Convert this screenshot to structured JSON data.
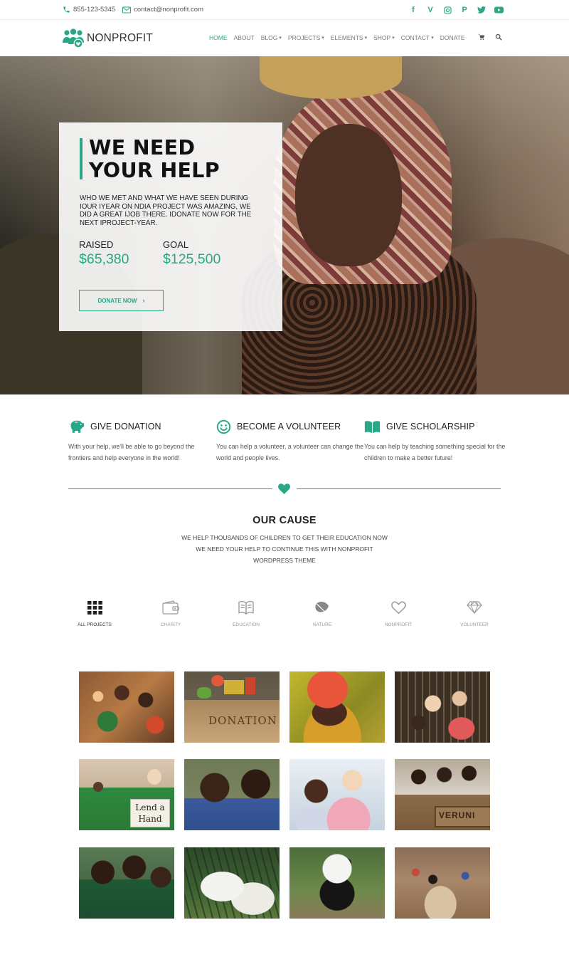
{
  "topbar": {
    "phone": "855-123-5345",
    "email": "contact@nonprofit.com",
    "social_icons": [
      "facebook-icon",
      "vine-icon",
      "instagram-icon",
      "paypal-icon",
      "twitter-icon",
      "youtube-icon"
    ]
  },
  "brand": {
    "name": "NONPROFIT",
    "accent_color": "#2aa787"
  },
  "nav": {
    "items": [
      {
        "label": "HOME",
        "active": true,
        "dropdown": false
      },
      {
        "label": "ABOUT",
        "active": false,
        "dropdown": false
      },
      {
        "label": "BLOG",
        "active": false,
        "dropdown": true
      },
      {
        "label": "PROJECTS",
        "active": false,
        "dropdown": true
      },
      {
        "label": "ELEMENTS",
        "active": false,
        "dropdown": true
      },
      {
        "label": "SHOP",
        "active": false,
        "dropdown": true
      },
      {
        "label": "CONTACT",
        "active": false,
        "dropdown": true
      },
      {
        "label": "DONATE",
        "active": false,
        "dropdown": false
      }
    ],
    "icons": [
      "cart-icon",
      "search-icon"
    ]
  },
  "hero": {
    "title_line1": "WE NEED",
    "title_line2": "YOUR HELP",
    "description": "WHO WE MET AND WHAT WE HAVE SEEN DURING IOUR IYEAR ON NDIA PROJECT WAS AMAZING, WE DID A GREAT IJOB THERE. IDONATE NOW FOR THE NEXT IPROJECT-YEAR.",
    "raised_label": "RAISED",
    "raised_value": "$65,380",
    "goal_label": "GOAL",
    "goal_value": "$125,500",
    "button_label": "DONATE NOW"
  },
  "features": [
    {
      "title": "GIVE DONATION",
      "icon": "piggy-bank-icon",
      "text": "With your help, we'll be able to go beyond the frontiers and help everyone in the world!"
    },
    {
      "title": "BECOME A VOLUNTEER",
      "icon": "smile-icon",
      "text": "You can help a volunteer, a volunteer can change the world and people lives."
    },
    {
      "title": "GIVE SCHOLARSHIP",
      "icon": "book-icon",
      "text": "You can help by teaching something special for the children to make a better future!"
    }
  ],
  "cause": {
    "title": "OUR CAUSE",
    "line1": "WE HELP THOUSANDS OF CHILDREN TO GET THEIR EDUCATION NOW",
    "line2": "WE NEED YOUR HELP TO CONTINUE THIS WITH NONPROFIT",
    "line3": "WORDPRESS THEME"
  },
  "filters": [
    {
      "label": "ALL PROJECTS",
      "icon": "grid-icon",
      "active": true
    },
    {
      "label": "CHARITY",
      "icon": "wallet-icon",
      "active": false
    },
    {
      "label": "EDUCATION",
      "icon": "book-open-icon",
      "active": false
    },
    {
      "label": "NATURE",
      "icon": "leaf-icon",
      "active": false
    },
    {
      "label": "NONPROFIT",
      "icon": "heart-icon",
      "active": false
    },
    {
      "label": "VOLUNTEER",
      "icon": "diamond-icon",
      "active": false
    }
  ],
  "gallery": [
    {
      "name": "children-group-photo"
    },
    {
      "name": "donation-box-photo",
      "label": "DONATION"
    },
    {
      "name": "woman-headwrap-photo"
    },
    {
      "name": "reading-children-photo"
    },
    {
      "name": "lend-a-hand-photo",
      "label": "Lend a Hand"
    },
    {
      "name": "two-boys-photo"
    },
    {
      "name": "teacher-child-photo"
    },
    {
      "name": "classroom-photo",
      "label": "VERUNI"
    },
    {
      "name": "schoolchildren-thumbs-up-photo"
    },
    {
      "name": "white-tigers-photo"
    },
    {
      "name": "panda-photo"
    },
    {
      "name": "kids-football-photo"
    }
  ]
}
